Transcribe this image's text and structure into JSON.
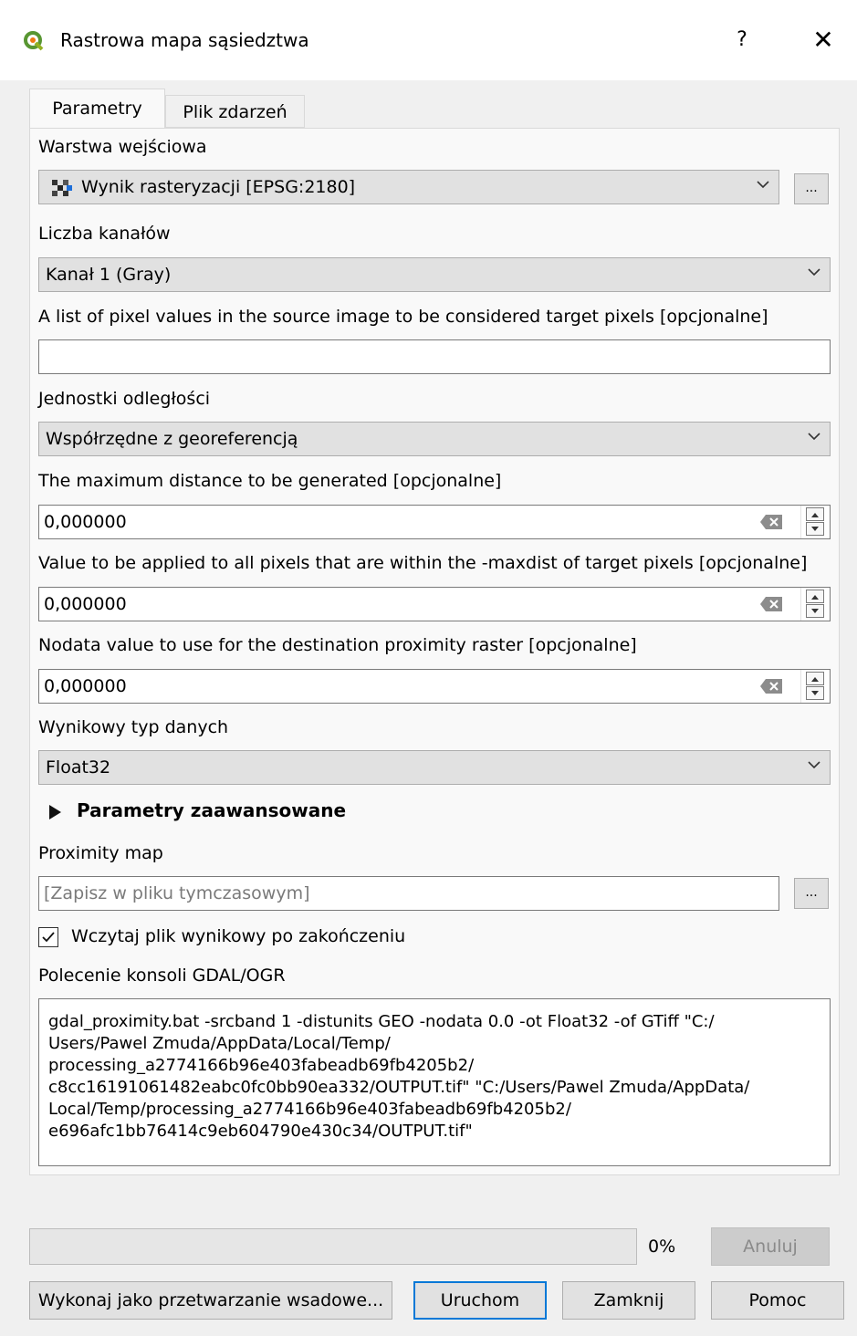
{
  "window": {
    "title": "Rastrowa mapa sąsiedztwa",
    "help_label": "?",
    "close_label": "✕"
  },
  "tabs": [
    {
      "label": "Parametry",
      "active": true
    },
    {
      "label": "Plik zdarzeń",
      "active": false
    }
  ],
  "fields": {
    "input_layer": {
      "label": "Warstwa wejściowa",
      "value": "Wynik rasteryzacji [EPSG:2180]"
    },
    "band": {
      "label": "Liczba kanałów",
      "value": "Kanał 1 (Gray)"
    },
    "target_values": {
      "label": "A list of pixel values in the source image to be considered target pixels [opcjonalne]",
      "value": ""
    },
    "distance_units": {
      "label": "Jednostki odległości",
      "value": "Współrzędne z georeferencją"
    },
    "max_distance": {
      "label": "The maximum distance to be generated [opcjonalne]",
      "value": "0,000000"
    },
    "replace_value": {
      "label": "Value to be applied to all pixels that are within the -maxdist of target pixels [opcjonalne]",
      "value": "0,000000"
    },
    "nodata": {
      "label": "Nodata value to use for the destination proximity raster [opcjonalne]",
      "value": "0,000000"
    },
    "data_type": {
      "label": "Wynikowy typ danych",
      "value": "Float32"
    },
    "advanced": {
      "label": "Parametry zaawansowane"
    },
    "output": {
      "label": "Proximity map",
      "placeholder": "[Zapisz w pliku tymczasowym]"
    },
    "load_output": {
      "label": "Wczytaj plik wynikowy po zakończeniu",
      "checked": true
    },
    "console": {
      "label": "Polecenie konsoli GDAL/OGR",
      "lines": [
        "gdal_proximity.bat -srcband 1 -distunits GEO -nodata 0.0 -ot Float32 -of GTiff \"C:/",
        "Users/Pawel Zmuda/AppData/Local/Temp/",
        "processing_a2774166b96e403fabeadb69fb4205b2/",
        "c8cc16191061482eabc0fc0bb90ea332/OUTPUT.tif\" \"C:/Users/Pawel Zmuda/AppData/",
        "Local/Temp/processing_a2774166b96e403fabeadb69fb4205b2/",
        "e696afc1bb76414c9eb604790e430c34/OUTPUT.tif\""
      ]
    }
  },
  "browse_label": "...",
  "progress": {
    "percent_label": "0%",
    "value": 0
  },
  "buttons": {
    "cancel": "Anuluj",
    "batch": "Wykonaj jako przetwarzanie wsadowe...",
    "run": "Uruchom",
    "close": "Zamknij",
    "help": "Pomoc"
  }
}
